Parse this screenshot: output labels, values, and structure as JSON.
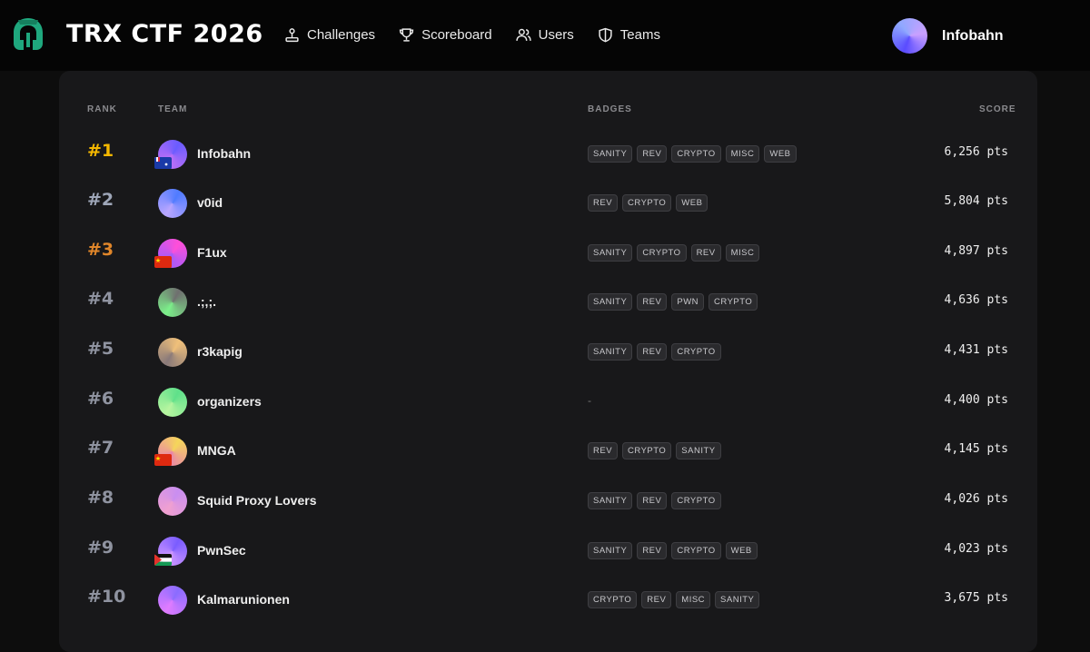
{
  "header": {
    "brand": "TRX CTF 2026",
    "nav": [
      {
        "label": "Challenges",
        "icon": "joystick-icon"
      },
      {
        "label": "Scoreboard",
        "icon": "trophy-icon"
      },
      {
        "label": "Users",
        "icon": "users-icon"
      },
      {
        "label": "Teams",
        "icon": "shield-icon"
      }
    ],
    "user": {
      "name": "Infobahn"
    }
  },
  "table": {
    "columns": {
      "rank": "RANK",
      "team": "TEAM",
      "badges": "BADGES",
      "score": "SCORE"
    },
    "rows": [
      {
        "rank": "#1",
        "team": "Infobahn",
        "badges": [
          "SANITY",
          "REV",
          "CRYPTO",
          "MISC",
          "WEB"
        ],
        "score": "6,256 pts",
        "flag": "fr-tf",
        "rank_color": "#f5b800",
        "avatar": [
          "#6a5cff",
          "#c471f5"
        ]
      },
      {
        "rank": "#2",
        "team": "v0id",
        "badges": [
          "REV",
          "CRYPTO",
          "WEB"
        ],
        "score": "5,804 pts",
        "flag": "",
        "rank_color": "#9ea6b8",
        "avatar": [
          "#4f7bff",
          "#b9a6ff"
        ]
      },
      {
        "rank": "#3",
        "team": "F1ux",
        "badges": [
          "SANITY",
          "CRYPTO",
          "REV",
          "MISC"
        ],
        "score": "4,897 pts",
        "flag": "cn",
        "rank_color": "#e0862a",
        "avatar": [
          "#ff4fd8",
          "#9b5cff"
        ]
      },
      {
        "rank": "#4",
        "team": ".;,;.",
        "badges": [
          "SANITY",
          "REV",
          "PWN",
          "CRYPTO"
        ],
        "score": "4,636 pts",
        "flag": "",
        "rank_color": "#8f93a0",
        "avatar": [
          "#6f6f6f",
          "#7cf08a"
        ]
      },
      {
        "rank": "#5",
        "team": "r3kapig",
        "badges": [
          "SANITY",
          "REV",
          "CRYPTO"
        ],
        "score": "4,431 pts",
        "flag": "",
        "rank_color": "#8f93a0",
        "avatar": [
          "#f0c07a",
          "#8a7a7a"
        ]
      },
      {
        "rank": "#6",
        "team": "organizers",
        "badges": [],
        "score": "4,400 pts",
        "flag": "",
        "rank_color": "#8f93a0",
        "avatar": [
          "#5fe08a",
          "#b8f5a0"
        ]
      },
      {
        "rank": "#7",
        "team": "MNGA",
        "badges": [
          "REV",
          "CRYPTO",
          "SANITY"
        ],
        "score": "4,145 pts",
        "flag": "cn",
        "rank_color": "#8f93a0",
        "avatar": [
          "#f5d65a",
          "#e87fb0"
        ]
      },
      {
        "rank": "#8",
        "team": "Squid Proxy Lovers",
        "badges": [
          "SANITY",
          "REV",
          "CRYPTO"
        ],
        "score": "4,026 pts",
        "flag": "",
        "rank_color": "#8f93a0",
        "avatar": [
          "#c98ef0",
          "#f0a0d0"
        ]
      },
      {
        "rank": "#9",
        "team": "PwnSec",
        "badges": [
          "SANITY",
          "REV",
          "CRYPTO",
          "WEB"
        ],
        "score": "4,023 pts",
        "flag": "ps",
        "rank_color": "#8f93a0",
        "avatar": [
          "#7a5cff",
          "#d49bff"
        ]
      },
      {
        "rank": "#10",
        "team": "Kalmarunionen",
        "badges": [
          "CRYPTO",
          "REV",
          "MISC",
          "SANITY"
        ],
        "score": "3,675 pts",
        "flag": "",
        "rank_color": "#8f93a0",
        "avatar": [
          "#8a6cff",
          "#e07cff"
        ]
      }
    ],
    "empty_badges": "-"
  }
}
